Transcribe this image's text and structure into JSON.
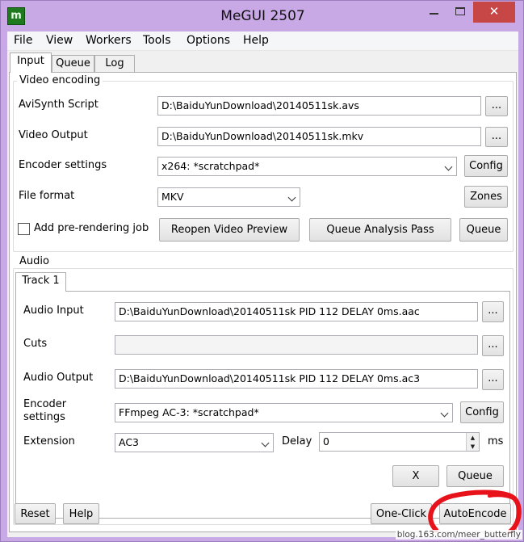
{
  "window": {
    "title": "MeGUI 2507",
    "app_icon_glyph": "m",
    "close_glyph": "✕"
  },
  "menu": [
    "File",
    "View",
    "Workers",
    "Tools",
    "Options",
    "Help"
  ],
  "tabs": [
    "Input",
    "Queue",
    "Log"
  ],
  "video": {
    "group_label": "Video encoding",
    "avisynth_label": "AviSynth Script",
    "avisynth_value": "D:\\BaiduYunDownload\\20140511sk.avs",
    "output_label": "Video Output",
    "output_value": "D:\\BaiduYunDownload\\20140511sk.mkv",
    "encoder_label": "Encoder settings",
    "encoder_value": "x264: *scratchpad*",
    "format_label": "File format",
    "format_value": "MKV",
    "browse_label": "...",
    "config_label": "Config",
    "zones_label": "Zones",
    "prerender_label": "Add pre-rendering job",
    "reopen_label": "Reopen Video Preview",
    "analysis_label": "Queue Analysis Pass",
    "queue_label": "Queue"
  },
  "audio": {
    "group_label": "Audio",
    "track_tab": "Track 1",
    "input_label": "Audio Input",
    "input_value": "D:\\BaiduYunDownload\\20140511sk PID 112 DELAY 0ms.aac",
    "cuts_label": "Cuts",
    "cuts_value": "",
    "output_label": "Audio Output",
    "output_value": "D:\\BaiduYunDownload\\20140511sk PID 112 DELAY 0ms.ac3",
    "encoder_label_line1": "Encoder",
    "encoder_label_line2": "settings",
    "encoder_value": "FFmpeg AC-3: *scratchpad*",
    "extension_label": "Extension",
    "extension_value": "AC3",
    "delay_label": "Delay",
    "delay_value": "0",
    "delay_unit": "ms",
    "browse_label": "...",
    "config_label": "Config",
    "x_label": "X",
    "queue_label": "Queue"
  },
  "footer": {
    "reset_label": "Reset",
    "help_label": "Help",
    "oneclick_label": "One-Click",
    "autoencode_label": "AutoEncode"
  },
  "watermark": "blog.163.com/meer_butterfly",
  "colors": {
    "titlebar": "#c9a8e6",
    "close": "#c74646",
    "annotation": "#e8121a"
  }
}
